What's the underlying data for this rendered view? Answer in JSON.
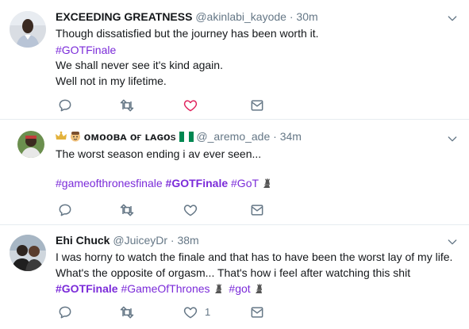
{
  "tweets": [
    {
      "name": "EXCEEDING GREATNESS",
      "handle": "@akinlabi_kayode",
      "sep": "·",
      "time": "30m",
      "lines": [
        "Though dissatisfied but the journey has been worth it."
      ],
      "hashtag": "#GOTFinale",
      "lines2": [
        "We shall never see it's kind again.",
        "Well not in my lifetime."
      ]
    },
    {
      "name": "ᴏᴍᴏᴏʙᴀ ᴏғ ʟᴀɢᴏs",
      "handle": "@_aremo_ade",
      "sep": "·",
      "time": "34m",
      "text": "The worst season ending i av ever seen...",
      "tags": [
        "#gameofthronesfinale",
        "#GOTFinale",
        "#GoT"
      ]
    },
    {
      "name": "Ehi Chuck",
      "handle": "@JuiceyDr",
      "sep": "·",
      "time": "38m",
      "lines": [
        "I was horny to watch the finale and that has to have been the worst lay of my life.",
        "What's the opposite of orgasm... That's how i feel after watching this shit"
      ],
      "tags": [
        "#GOTFinale",
        "#GameOfThrones",
        "#got"
      ],
      "like_count": "1"
    }
  ],
  "colors": {
    "hashtag": "#7b2bd9",
    "icon": "#657786",
    "like_outline": "#e0245e",
    "divider": "#e6ecf0"
  },
  "icons": [
    "reply-icon",
    "retweet-icon",
    "like-icon",
    "dm-icon",
    "caret-down-icon",
    "iron-throne-icon",
    "nigeria-flag-icon",
    "crown-icon",
    "face-emoji-icon"
  ]
}
